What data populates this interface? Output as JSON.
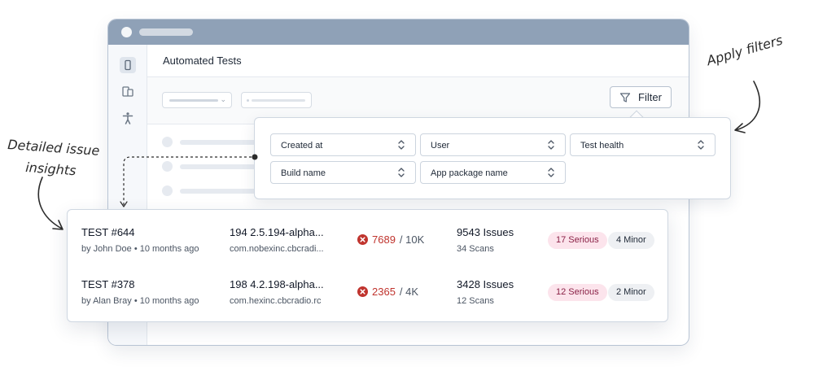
{
  "annotations": {
    "apply_filters": "Apply filters",
    "insights_line1": "Detailed issue",
    "insights_line2": "insights"
  },
  "app": {
    "page_title": "Automated Tests",
    "filter_button_label": "Filter"
  },
  "filter_panel": {
    "fields": [
      "Created at",
      "User",
      "Test health",
      "Build name",
      "App package name"
    ]
  },
  "results": [
    {
      "test_id": "TEST #644",
      "author": "by John Doe • 10 months ago",
      "build": "194 2.5.194-alpha...",
      "package": "com.nobexinc.cbcradi...",
      "errors": "7689",
      "total": "/ 10K",
      "issues": "9543 Issues",
      "scans": "34 Scans",
      "serious": "17 Serious",
      "minor": "4 Minor"
    },
    {
      "test_id": "TEST #378",
      "author": "by Alan Bray • 10 months ago",
      "build": "198 4.2.198-alpha...",
      "package": "com.hexinc.cbcradio.rc",
      "errors": "2365",
      "total": "/ 4K",
      "issues": "3428 Issues",
      "scans": "12 Scans",
      "serious": "12 Serious",
      "minor": "2 Minor"
    }
  ],
  "colors": {
    "titlebar": "#8fa1b7",
    "error_red": "#c0342e",
    "serious_bg": "#fce4ec",
    "serious_text": "#8a2146",
    "minor_bg": "#eef0f3"
  },
  "icons": {
    "sidebar": [
      "mobile-device-icon",
      "multi-device-icon",
      "accessibility-icon"
    ],
    "filter": "funnel-icon",
    "select": "chevron-up-down-icon",
    "error": "error-x-circle-icon"
  }
}
